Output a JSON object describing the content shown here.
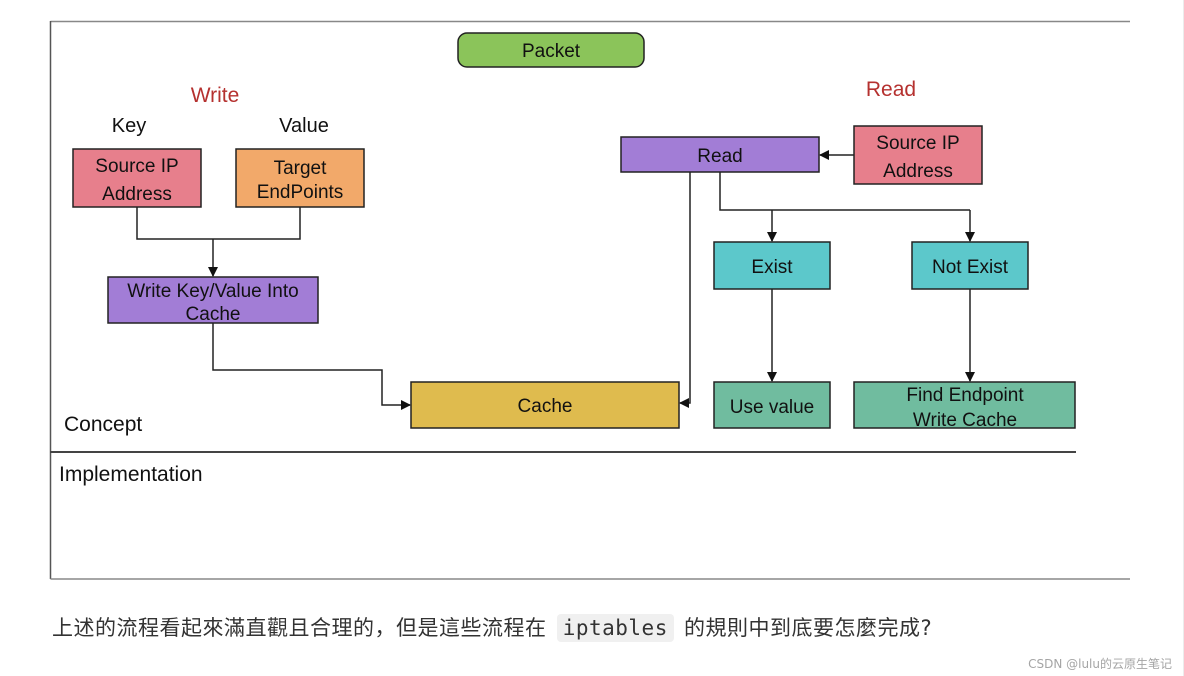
{
  "diagram": {
    "top_node": {
      "label": "Packet",
      "color": "#8bc45a"
    },
    "write_section": {
      "title": "Write",
      "key_label": "Key",
      "value_label": "Value",
      "source_node": {
        "lines": [
          "Source IP",
          "Address"
        ],
        "color": "#e77f8c"
      },
      "target_node": {
        "lines": [
          "Target",
          "EndPoints"
        ],
        "color": "#f2a96a"
      },
      "write_node": {
        "lines": [
          "Write Key/Value Into",
          "Cache"
        ],
        "color": "#a27dd6"
      }
    },
    "read_section": {
      "title": "Read",
      "read_node": {
        "label": "Read",
        "color": "#a27dd6"
      },
      "source_node": {
        "lines": [
          "Source IP",
          "Address"
        ],
        "color": "#e77f8c"
      },
      "exist_node": {
        "label": "Exist",
        "color": "#5cc8cb"
      },
      "not_exist_node": {
        "label": "Not Exist",
        "color": "#5cc8cb"
      },
      "use_value_node": {
        "label": "Use value",
        "color": "#70bc9f"
      },
      "find_endpoint_node": {
        "lines": [
          "Find Endpoint",
          "Write Cache"
        ],
        "color": "#70bc9f"
      }
    },
    "cache_node": {
      "label": "Cache",
      "color": "#dfbb4e"
    },
    "sections": {
      "concept": "Concept",
      "implementation": "Implementation"
    }
  },
  "caption": {
    "before": "上述的流程看起來滿直觀且合理的，但是這些流程在",
    "code": "iptables",
    "after": "的規則中到底要怎麼完成?"
  },
  "watermark": "CSDN @lulu的云原生笔记"
}
